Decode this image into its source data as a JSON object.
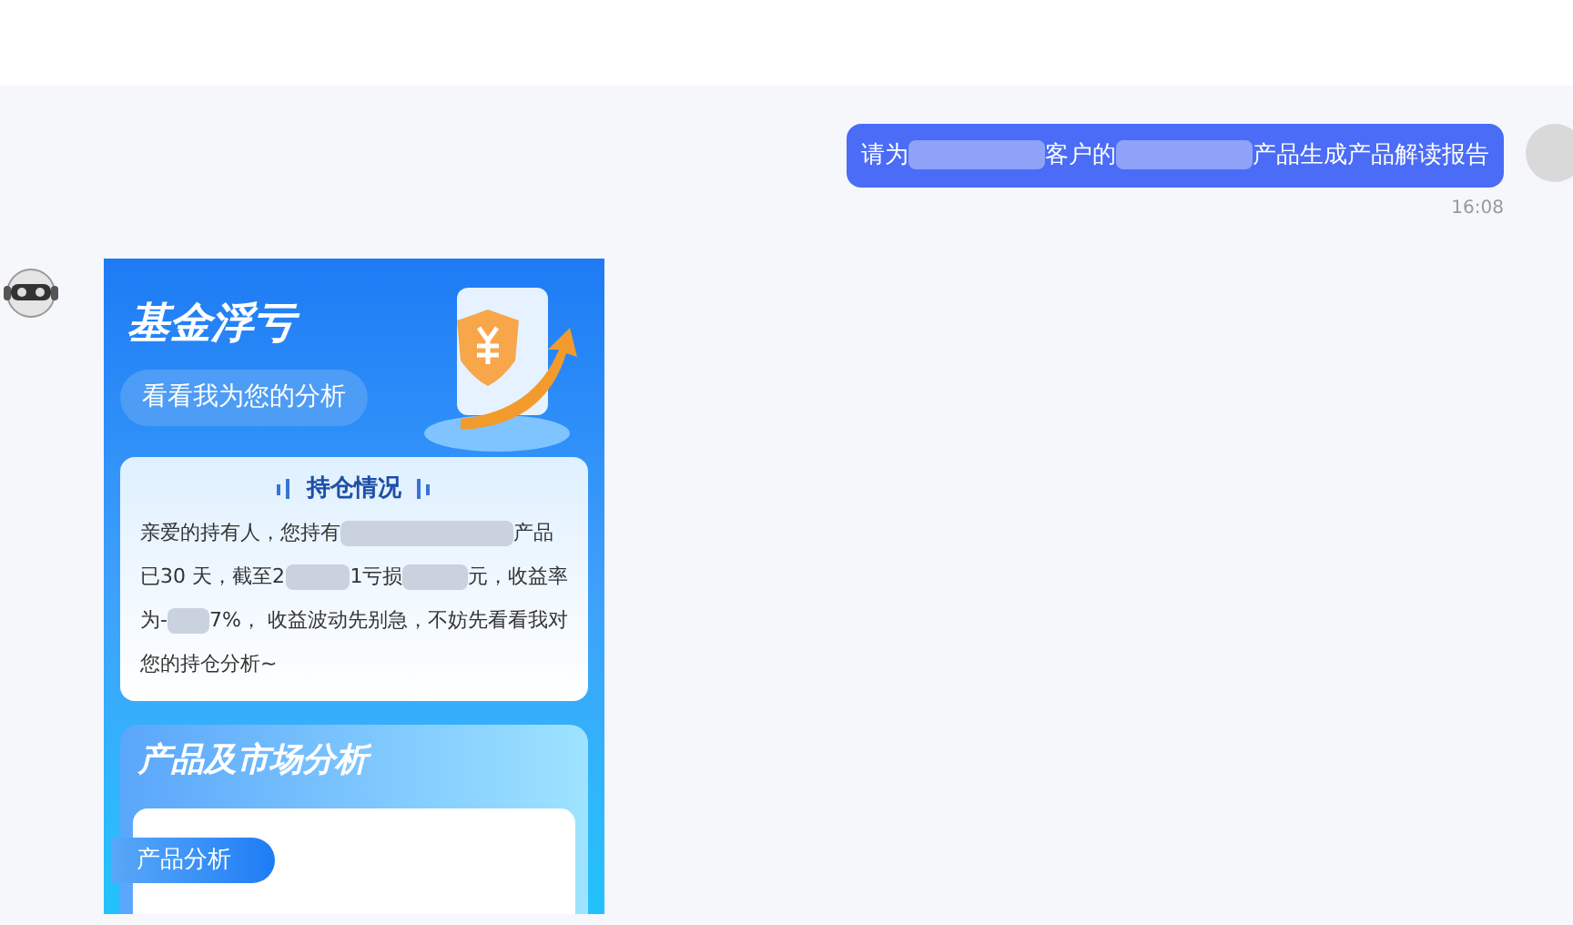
{
  "user_message": {
    "segments": [
      {
        "kind": "text",
        "text": "请为"
      },
      {
        "kind": "redacted"
      },
      {
        "kind": "text",
        "text": "客户的"
      },
      {
        "kind": "redacted"
      },
      {
        "kind": "text",
        "text": "产品生成产品解读报告"
      }
    ],
    "time": "16:08"
  },
  "report": {
    "title": "基金浮亏",
    "subtitle": "看看我为您的分析",
    "holding": {
      "title": "持仓情况",
      "lines": [
        [
          {
            "kind": "text",
            "text": "亲爱的持有人，您持有"
          },
          {
            "kind": "redacted"
          },
          {
            "kind": "text",
            "text": "产品"
          }
        ],
        [
          {
            "kind": "text",
            "text": "已30 天，截至2"
          },
          {
            "kind": "redacted"
          },
          {
            "kind": "text",
            "text": "1亏损"
          },
          {
            "kind": "redacted"
          },
          {
            "kind": "text",
            "text": "元，收益率"
          }
        ],
        [
          {
            "kind": "text",
            "text": "为-"
          },
          {
            "kind": "redacted"
          },
          {
            "kind": "text",
            "text": "7%， 收益波动先别急，不妨先看看我对"
          }
        ],
        [
          {
            "kind": "text",
            "text": "您的持仓分析~"
          }
        ]
      ]
    },
    "section": {
      "title": "产品及市场分析",
      "tab": "产品分析"
    }
  }
}
